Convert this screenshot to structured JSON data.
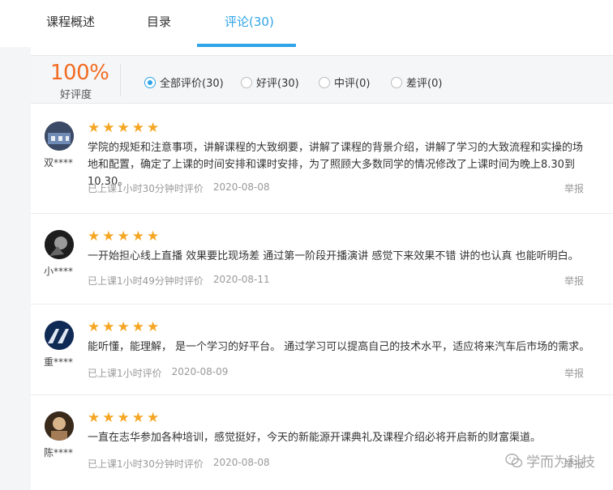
{
  "tabs": [
    {
      "label": "课程概述"
    },
    {
      "label": "目录"
    },
    {
      "label": "评论(30)"
    }
  ],
  "summary": {
    "percent": "100%",
    "label": "好评度"
  },
  "filters": [
    {
      "label": "全部评价(30)",
      "checked": true
    },
    {
      "label": "好评(30)",
      "checked": false
    },
    {
      "label": "中评(0)",
      "checked": false
    },
    {
      "label": "差评(0)",
      "checked": false
    }
  ],
  "reviews": [
    {
      "user": "双****",
      "stars": "★★★★★",
      "content": "学院的规矩和注意事项，讲解课程的大致纲要，讲解了课程的背景介绍，讲解了学习的大致流程和实操的场地和配置，确定了上课的时间安排和课时安排，为了照顾大多数同学的情况修改了上课时间为晚上8.30到10.30。",
      "duration": "已上课1小时30分钟时评价",
      "date": "2020-08-08",
      "report": "举报"
    },
    {
      "user": "小****",
      "stars": "★★★★★",
      "content": "一开始担心线上直播 效果要比现场差 通过第一阶段开播演讲 感觉下来效果不错 讲的也认真 也能听明白。",
      "duration": "已上课1小时49分钟时评价",
      "date": "2020-08-11",
      "report": "举报"
    },
    {
      "user": "重****",
      "stars": "★★★★★",
      "content": "能听懂，能理解， 是一个学习的好平台。 通过学习可以提高自己的技术水平，适应将来汽车后市场的需求。",
      "duration": "已上课1小时评价",
      "date": "2020-08-09",
      "report": "举报"
    },
    {
      "user": "陈****",
      "stars": "★★★★★",
      "content": "一直在志华参加各种培训，感觉挺好，今天的新能源开课典礼及课程介绍必将开启新的财富渠道。",
      "duration": "已上课1小时30分钟时评价",
      "date": "2020-08-08",
      "report": "举报"
    }
  ],
  "watermark": {
    "text": "学而为科技",
    "icon": "wechat-icon"
  }
}
